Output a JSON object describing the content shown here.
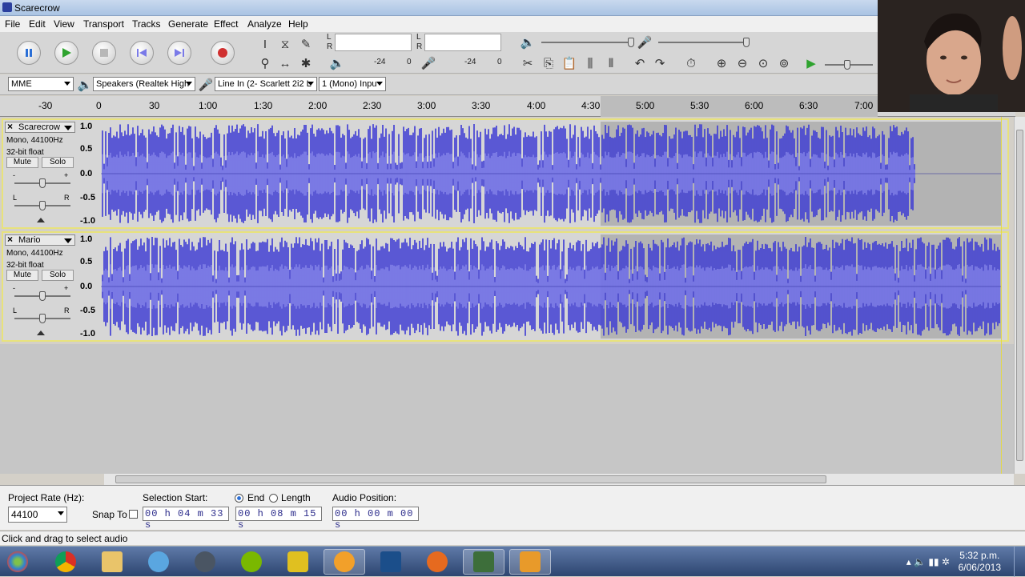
{
  "window": {
    "title": "Scarecrow"
  },
  "menu": [
    "File",
    "Edit",
    "View",
    "Transport",
    "Tracks",
    "Generate",
    "Effect",
    "Analyze",
    "Help"
  ],
  "meters": {
    "play_label_l": "L",
    "play_label_r": "R",
    "rec_label_l": "L",
    "rec_label_r": "R",
    "play_db_left": "-24",
    "play_zero": "0",
    "rec_db_left": "-24",
    "rec_zero": "0"
  },
  "devices": {
    "host": "MME",
    "output": "Speakers (Realtek High",
    "input": "Line In (2- Scarlett 2i2 L",
    "channels": "1 (Mono) Inpu"
  },
  "ruler": [
    "-30",
    "0",
    "30",
    "1:00",
    "1:30",
    "2:00",
    "2:30",
    "3:00",
    "3:30",
    "4:00",
    "4:30",
    "5:00",
    "5:30",
    "6:00",
    "6:30",
    "7:00"
  ],
  "tracks": [
    {
      "name": "Scarecrow",
      "format": "Mono, 44100Hz",
      "depth": "32-bit float",
      "mute": "Mute",
      "solo": "Solo",
      "gain_minus": "-",
      "gain_plus": "+",
      "pan_l": "L",
      "pan_r": "R",
      "scale": [
        "1.0",
        "0.5",
        "0.0",
        "-0.5",
        "-1.0"
      ],
      "audio_end_fraction": 0.905
    },
    {
      "name": "Mario",
      "format": "Mono, 44100Hz",
      "depth": "32-bit float",
      "mute": "Mute",
      "solo": "Solo",
      "gain_minus": "-",
      "gain_plus": "+",
      "pan_l": "L",
      "pan_r": "R",
      "scale": [
        "1.0",
        "0.5",
        "0.0",
        "-0.5",
        "-1.0"
      ],
      "audio_end_fraction": 1.0
    }
  ],
  "selection_bar": {
    "project_rate_label": "Project Rate (Hz):",
    "project_rate": "44100",
    "snap_label": "Snap To",
    "selection_start_label": "Selection Start:",
    "selection_start": "00 h 04 m 33 s",
    "end_label": "End",
    "length_label": "Length",
    "selection_end": "00 h 08 m 15 s",
    "audio_position_label": "Audio Position:",
    "audio_position": "00 h 00 m 00 s"
  },
  "status": "Click and drag to select audio",
  "taskbar": {
    "time": "5:32 p.m.",
    "date": "6/06/2013",
    "apps": [
      "windows-start",
      "chrome",
      "explorer",
      "itunes",
      "steam",
      "spotify",
      "winamp",
      "audacity",
      "photoshop",
      "firefox",
      "camtasia-recorder",
      "camtasia-studio"
    ]
  },
  "colors": {
    "waveform": "#3b39d4",
    "waveform_light": "#7a7ae8",
    "selection_bg": "#b3b3b3",
    "track_border": "#e8e27c"
  }
}
